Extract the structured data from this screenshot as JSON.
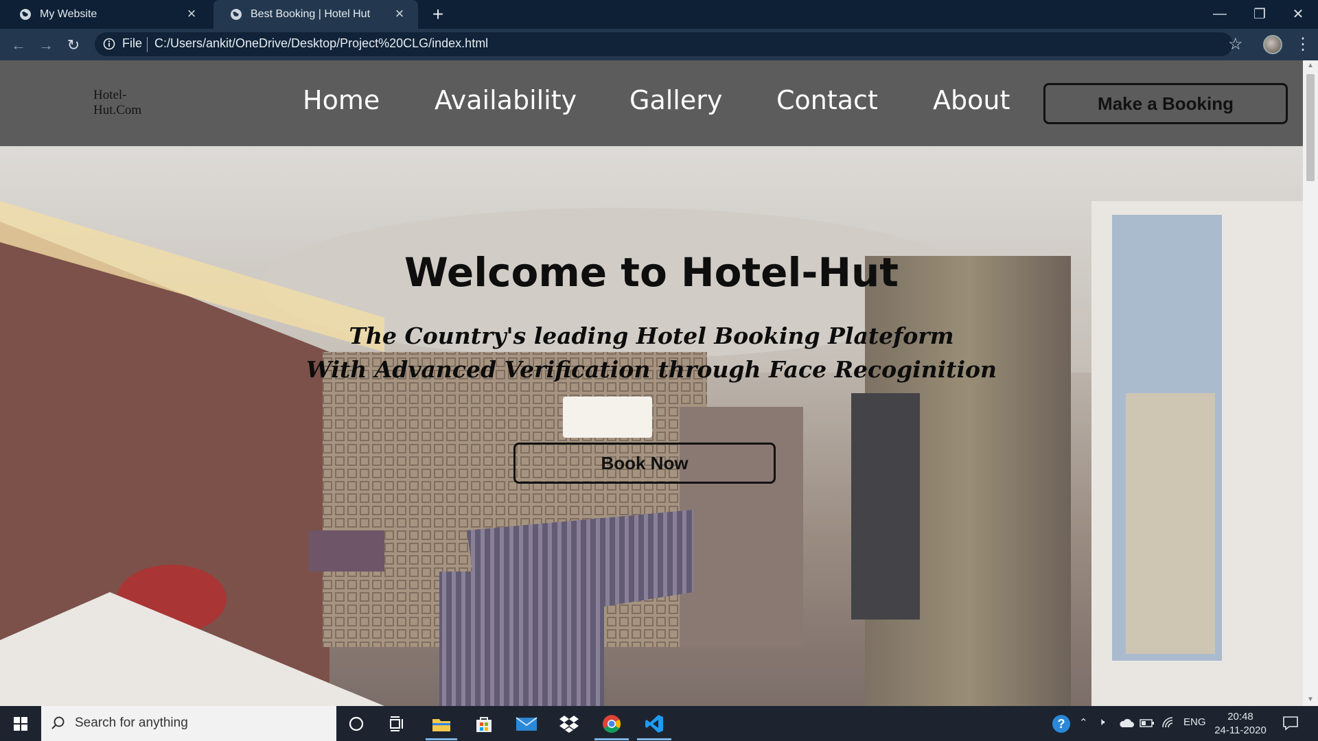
{
  "browser": {
    "tabs": [
      {
        "title": "My Website",
        "active": false
      },
      {
        "title": "Best Booking | Hotel Hut",
        "active": true
      }
    ],
    "address": {
      "scheme_label": "File",
      "url": "C:/Users/ankit/OneDrive/Desktop/Project%20CLG/index.html"
    }
  },
  "site": {
    "logo_alt": "Hotel-Hut.Com",
    "nav": [
      "Home",
      "Availability",
      "Gallery",
      "Contact",
      "About"
    ],
    "cta_label": "Make a Booking",
    "hero": {
      "title": "Welcome to Hotel-Hut",
      "subtitle_line1": "The Country's leading Hotel Booking Plateform",
      "subtitle_line2": "With Advanced Verification through Face Recoginition",
      "button_label": "Book Now"
    }
  },
  "taskbar": {
    "search_placeholder": "Search for anything",
    "language": "ENG",
    "time": "20:48",
    "date": "24-11-2020",
    "pinned_icons": [
      "cortana-icon",
      "task-view-icon",
      "file-explorer-icon",
      "store-icon",
      "mail-icon",
      "dropbox-icon",
      "chrome-icon",
      "vscode-icon"
    ]
  },
  "colors": {
    "tab_bar": "#0d2036",
    "toolbar": "#23384f",
    "site_header": "#5c5c5c",
    "taskbar": "#1d2430"
  }
}
